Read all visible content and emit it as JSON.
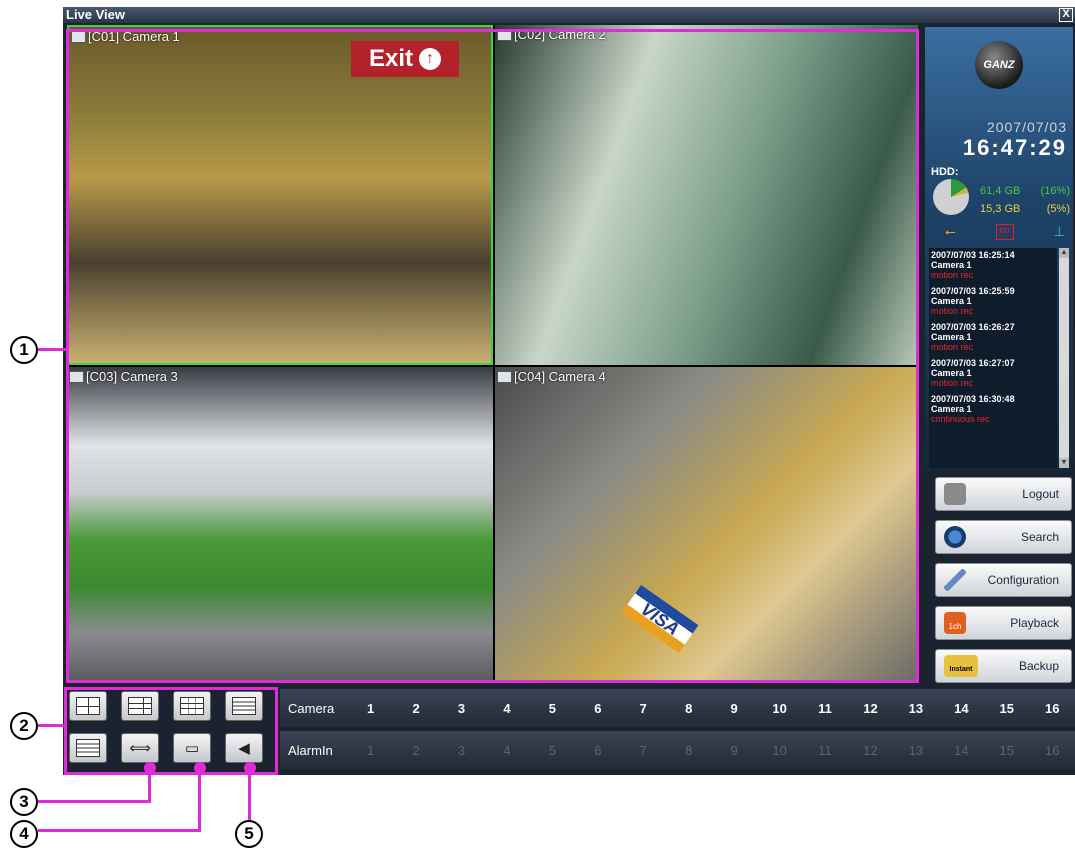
{
  "window": {
    "title": "Live View",
    "close": "X"
  },
  "cameras": [
    {
      "label": "[C01] Camera 1"
    },
    {
      "label": "[C02] Camera 2"
    },
    {
      "label": "[C03] Camera 3"
    },
    {
      "label": "[C04] Camera 4"
    }
  ],
  "scene_text": {
    "exit_sign": "Exit",
    "exit_arrow": "↑",
    "card_brand": "VISA"
  },
  "side": {
    "logo": "GANZ",
    "date": "2007/07/03",
    "time": "16:47:29",
    "hdd_label": "HDD:",
    "hdd": [
      {
        "size": "61,4 GB",
        "pct": "(16%)",
        "color": "#46c846"
      },
      {
        "size": "15,3 GB",
        "pct": "(5%)",
        "color": "#e8d040"
      }
    ],
    "devices": [
      "usb-icon",
      "tape-icon",
      "network-icon"
    ],
    "log": [
      {
        "time": "2007/07/03 16:25:14",
        "camera": "Camera 1",
        "event": "motion rec"
      },
      {
        "time": "2007/07/03 16:25:59",
        "camera": "Camera 1",
        "event": "motion rec"
      },
      {
        "time": "2007/07/03 16:26:27",
        "camera": "Camera 1",
        "event": "motion rec"
      },
      {
        "time": "2007/07/03 16:27:07",
        "camera": "Camera 1",
        "event": "motion rec"
      },
      {
        "time": "2007/07/03 16:30:48",
        "camera": "Camera 1",
        "event": "continuous rec"
      }
    ]
  },
  "buttons": [
    {
      "label": "Logout",
      "icon": "lock-icon"
    },
    {
      "label": "Search",
      "icon": "magnifier-icon"
    },
    {
      "label": "Configuration",
      "icon": "wrench-icon"
    },
    {
      "label": "Playback",
      "icon": "playback-icon",
      "badge": "1ch"
    },
    {
      "label": "Backup",
      "icon": "backup-icon",
      "badge": "Instant"
    }
  ],
  "channels": {
    "camera_label": "Camera",
    "alarm_label": "AlarmIn",
    "numbers": [
      "1",
      "2",
      "3",
      "4",
      "5",
      "6",
      "7",
      "8",
      "9",
      "10",
      "11",
      "12",
      "13",
      "14",
      "15",
      "16"
    ]
  },
  "callouts": [
    "1",
    "2",
    "3",
    "4",
    "5"
  ],
  "colors": {
    "accent": "#e02bd8",
    "selected_border": "#39d24a",
    "log_event": "#e8262a"
  }
}
